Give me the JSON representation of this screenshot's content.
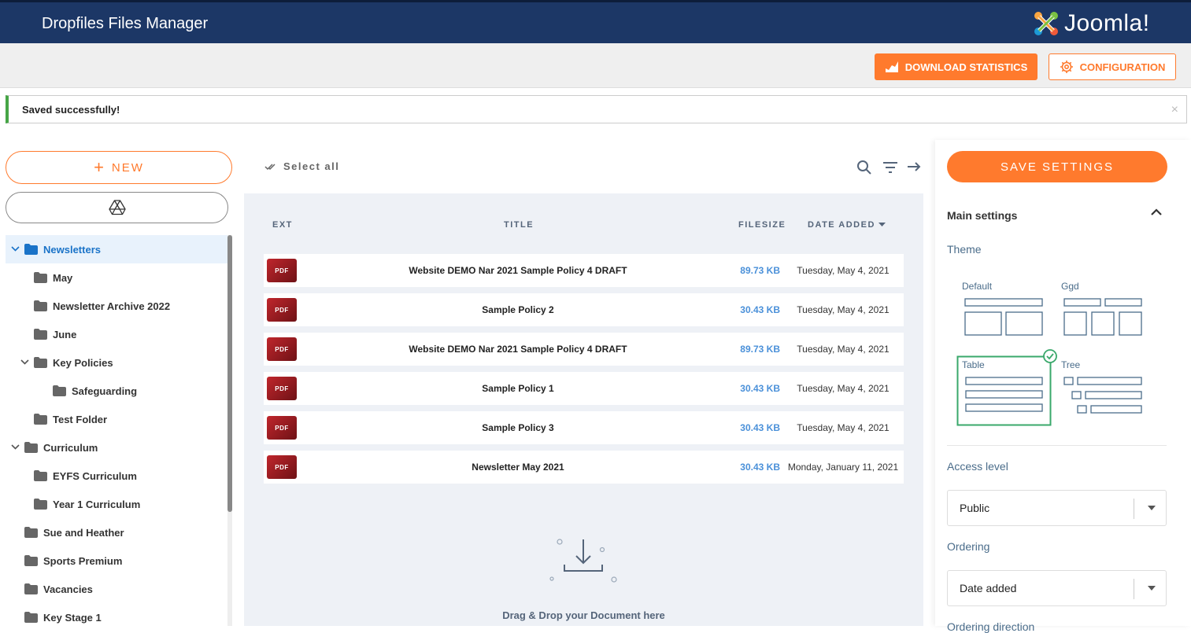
{
  "header": {
    "title": "Dropfiles Files Manager",
    "brand": "Joomla!"
  },
  "toolbar": {
    "stats_label": "DOWNLOAD STATISTICS",
    "config_label": "CONFIGURATION"
  },
  "alert": {
    "message": "Saved successfully!",
    "close": "×"
  },
  "sidebar": {
    "new_label": "NEW",
    "new_icon": "+",
    "tree": [
      {
        "label": "Newsletters",
        "level": 0,
        "expanded": true,
        "active": true
      },
      {
        "label": "May",
        "level": 1
      },
      {
        "label": "Newsletter Archive 2022",
        "level": 1
      },
      {
        "label": "June",
        "level": 1
      },
      {
        "label": "Key Policies",
        "level": 1,
        "expanded": true
      },
      {
        "label": "Safeguarding",
        "level": 2
      },
      {
        "label": "Test Folder",
        "level": 1
      },
      {
        "label": "Curriculum",
        "level": 0,
        "expanded": true
      },
      {
        "label": "EYFS Curriculum",
        "level": 1
      },
      {
        "label": "Year 1 Curriculum",
        "level": 1
      },
      {
        "label": "Sue and Heather",
        "level": 0
      },
      {
        "label": "Sports Premium",
        "level": 0
      },
      {
        "label": "Vacancies",
        "level": 0
      },
      {
        "label": "Key Stage 1",
        "level": 0
      }
    ]
  },
  "files": {
    "select_all": "Select all",
    "columns": {
      "ext": "EXT",
      "title": "TITLE",
      "filesize": "FILESIZE",
      "date": "DATE ADDED"
    },
    "rows": [
      {
        "ext": "PDF",
        "title": "Website DEMO Nar 2021 Sample Policy 4 DRAFT",
        "size": "89.73 KB",
        "date": "Tuesday, May 4, 2021"
      },
      {
        "ext": "PDF",
        "title": "Sample Policy 2",
        "size": "30.43 KB",
        "date": "Tuesday, May 4, 2021"
      },
      {
        "ext": "PDF",
        "title": "Website DEMO Nar 2021 Sample Policy 4 DRAFT",
        "size": "89.73 KB",
        "date": "Tuesday, May 4, 2021"
      },
      {
        "ext": "PDF",
        "title": "Sample Policy 1",
        "size": "30.43 KB",
        "date": "Tuesday, May 4, 2021"
      },
      {
        "ext": "PDF",
        "title": "Sample Policy 3",
        "size": "30.43 KB",
        "date": "Tuesday, May 4, 2021"
      },
      {
        "ext": "PDF",
        "title": "Newsletter May 2021",
        "size": "30.43 KB",
        "date": "Monday, January 11, 2021"
      }
    ],
    "drop_text": "Drag & Drop your Document here"
  },
  "settings": {
    "save_label": "SAVE SETTINGS",
    "main_settings": "Main settings",
    "theme_label": "Theme",
    "themes": [
      {
        "name": "Default",
        "selected": false
      },
      {
        "name": "Ggd",
        "selected": false
      },
      {
        "name": "Table",
        "selected": true
      },
      {
        "name": "Tree",
        "selected": false
      }
    ],
    "access_label": "Access level",
    "access_value": "Public",
    "ordering_label": "Ordering",
    "ordering_value": "Date added",
    "ordering_direction_label": "Ordering direction"
  },
  "colors": {
    "header_bg": "#1c3766",
    "accent": "#ff7a2d",
    "link": "#4a90d9",
    "success": "#46a546",
    "theme_selected": "#3aa86b"
  }
}
